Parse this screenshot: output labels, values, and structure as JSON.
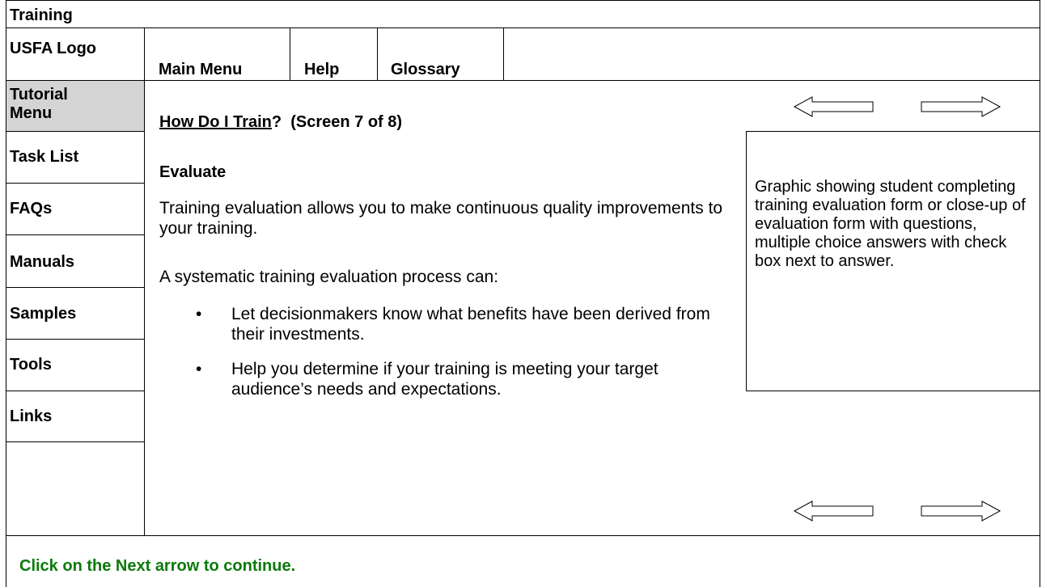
{
  "header": {
    "title": "Training"
  },
  "logo": {
    "label": "USFA Logo"
  },
  "topnav": {
    "main_menu": "Main Menu",
    "help": "Help",
    "glossary": "Glossary"
  },
  "sidebar": {
    "tutorial_menu": "Tutorial Menu",
    "items": [
      "Task List",
      "FAQs",
      "Manuals",
      "Samples",
      "Tools",
      "Links"
    ]
  },
  "content": {
    "screen_link": "How Do I Train",
    "screen_suffix": "?  (Screen 7 of 8)",
    "heading": "Evaluate",
    "para1": "Training evaluation allows you to make continuous quality improvements to your training.",
    "para2": "A systematic training evaluation process can:",
    "bullet_glyph": "•",
    "bullets": [
      "Let decisionmakers know what benefits have been derived from their investments.",
      "Help you determine if your training is meeting your target audience’s needs and expectations."
    ]
  },
  "graphic": {
    "caption": "Graphic showing student completing training evaluation form or close-up of evaluation form with questions, multiple choice answers with check box next to answer."
  },
  "nav_arrows": {
    "prev_icon": "left-arrow-icon",
    "next_icon": "right-arrow-icon"
  },
  "footer": {
    "instruction": "Click on the Next arrow to continue.",
    "instruction_color": "#0b7a0b"
  }
}
